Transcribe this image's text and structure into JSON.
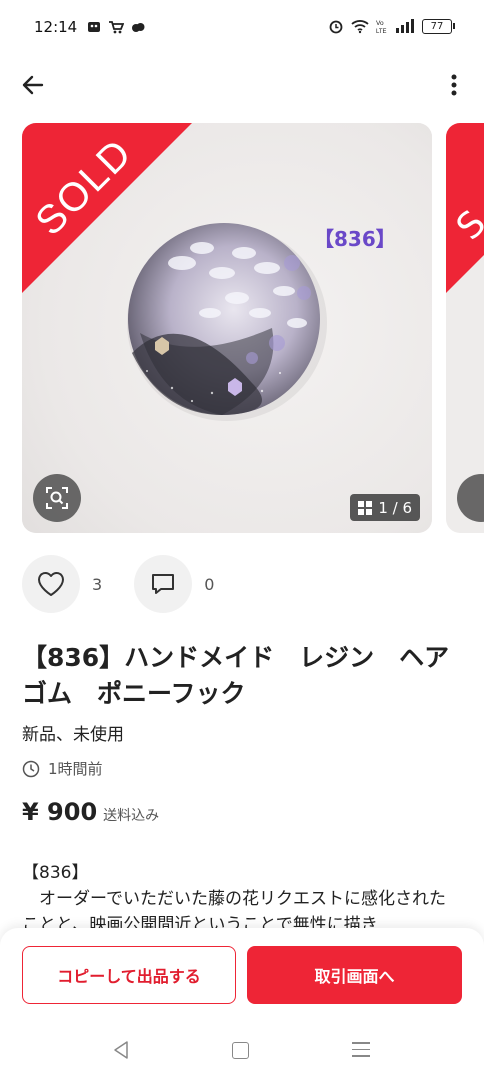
{
  "status_bar": {
    "time": "12:14",
    "battery": "77"
  },
  "product": {
    "sold_label": "SOLD",
    "image_code": "【836】",
    "image_counter": "1 / 6",
    "likes": "3",
    "comments": "0",
    "title": "【836】ハンドメイド　レジン　ヘアゴム　ポニーフック",
    "condition": "新品、未使用",
    "posted": "1時間前",
    "price": "¥ 900",
    "shipping": "送料込み",
    "description": [
      "【836】",
      "　オーダーでいただいた藤の花リクエストに感化されたことと、映画公開間近ということで無性に描き"
    ]
  },
  "buttons": {
    "copy_listing": "コピーして出品する",
    "trade_screen": "取引画面へ"
  },
  "colors": {
    "accent": "#ee2536",
    "code_purple": "#6a48c8"
  }
}
